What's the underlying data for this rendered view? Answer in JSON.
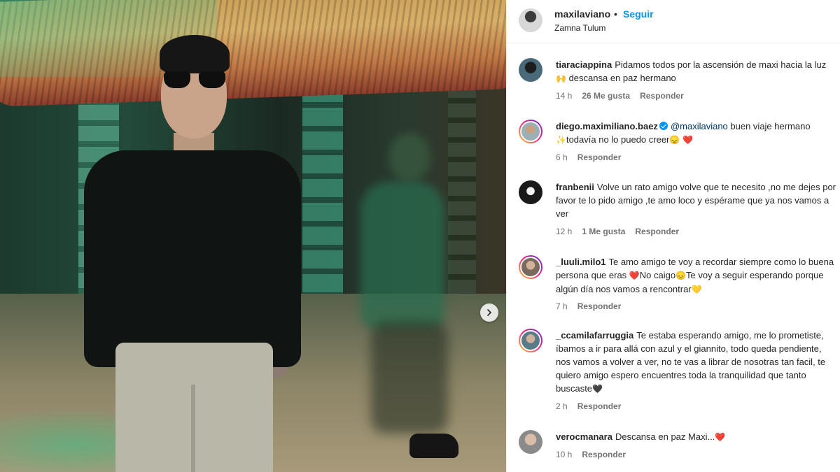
{
  "post": {
    "username": "maxilaviano",
    "dot": "•",
    "follow_label": "Seguir",
    "location": "Zamna Tulum"
  },
  "comments": [
    {
      "username": "tiaraciappina",
      "text_before": "Pidamos todos por la ascensión de maxi hacia la luz",
      "emoji": "🙌",
      "text_after": " descansa en paz hermano",
      "time": "14 h",
      "likes": "26 Me gusta",
      "reply": "Responder"
    },
    {
      "username": "diego.maximiliano.baez",
      "verified": true,
      "mention": "@maxilaviano",
      "text": " buen viaje hermano ",
      "emoji1": "✨",
      "text2": "todavía no lo puedo creer",
      "emoji2": "😞",
      "emoji3": "❤️",
      "time": "6 h",
      "reply": "Responder"
    },
    {
      "username": "franbenii",
      "text": "Volve un rato amigo volve que te necesito ,no me dejes por favor te lo pido amigo ,te amo loco y espérame que ya nos vamos a ver",
      "time": "12 h",
      "likes": "1 Me gusta",
      "reply": "Responder"
    },
    {
      "username": "_luuli.milo1",
      "text1": "Te amo amigo te voy a recordar siempre como lo buena persona que eras ",
      "emoji1": "❤️",
      "text2": "No caigo",
      "emoji2": "😞",
      "text3": "Te voy a seguir esperando porque algún día nos vamos a rencontrar",
      "emoji3": "💛",
      "time": "7 h",
      "reply": "Responder"
    },
    {
      "username": "_ccamilafarruggia",
      "text": "Te estaba esperando amigo, me lo prometiste, íbamos a ir para allá con azul y el giannito, todo queda pendiente, nos vamos a volver a ver, no te vas a librar de nosotras tan facil, te quiero amigo espero encuentres toda la tranquilidad que tanto buscaste",
      "emoji": "🖤",
      "time": "2 h",
      "reply": "Responder"
    },
    {
      "username": "verocmanara",
      "text": "Descansa en paz Maxi...",
      "emoji": "❤️",
      "time": "10 h",
      "reply": "Responder"
    }
  ],
  "icons": {
    "next": "chevron-right-icon",
    "verified": "verified-badge-icon"
  },
  "colors": {
    "link": "#0095f6",
    "meta": "#737373",
    "text": "#262626"
  }
}
